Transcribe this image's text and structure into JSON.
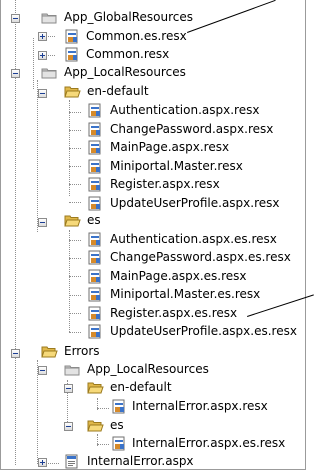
{
  "tree": {
    "items": [
      {
        "label": "App_GlobalResources",
        "icon": "folder-icon"
      },
      {
        "label": "Common.es.resx",
        "icon": "resx-file-icon"
      },
      {
        "label": "Common.resx",
        "icon": "resx-file-icon"
      },
      {
        "label": "App_LocalResources",
        "icon": "folder-icon"
      },
      {
        "label": "en-default",
        "icon": "folder-open-icon"
      },
      {
        "label": "Authentication.aspx.resx",
        "icon": "resx-file-icon"
      },
      {
        "label": "ChangePassword.aspx.resx",
        "icon": "resx-file-icon"
      },
      {
        "label": "MainPage.aspx.resx",
        "icon": "resx-file-icon"
      },
      {
        "label": "Miniportal.Master.resx",
        "icon": "resx-file-icon"
      },
      {
        "label": "Register.aspx.resx",
        "icon": "resx-file-icon"
      },
      {
        "label": "UpdateUserProfile.aspx.resx",
        "icon": "resx-file-icon"
      },
      {
        "label": "es",
        "icon": "folder-open-icon"
      },
      {
        "label": "Authentication.aspx.es.resx",
        "icon": "resx-file-icon"
      },
      {
        "label": "ChangePassword.aspx.es.resx",
        "icon": "resx-file-icon"
      },
      {
        "label": "MainPage.aspx.es.resx",
        "icon": "resx-file-icon"
      },
      {
        "label": "Miniportal.Master.es.resx",
        "icon": "resx-file-icon"
      },
      {
        "label": "Register.aspx.es.resx",
        "icon": "resx-file-icon"
      },
      {
        "label": "UpdateUserProfile.aspx.es.resx",
        "icon": "resx-file-icon"
      },
      {
        "label": "Errors",
        "icon": "folder-open-icon"
      },
      {
        "label": "App_LocalResources",
        "icon": "folder-icon"
      },
      {
        "label": "en-default",
        "icon": "folder-open-icon"
      },
      {
        "label": "InternalError.aspx.resx",
        "icon": "resx-file-icon"
      },
      {
        "label": "es",
        "icon": "folder-open-icon"
      },
      {
        "label": "InternalError.aspx.es.resx",
        "icon": "resx-file-icon"
      },
      {
        "label": "InternalError.aspx",
        "icon": "aspx-file-icon"
      }
    ]
  }
}
